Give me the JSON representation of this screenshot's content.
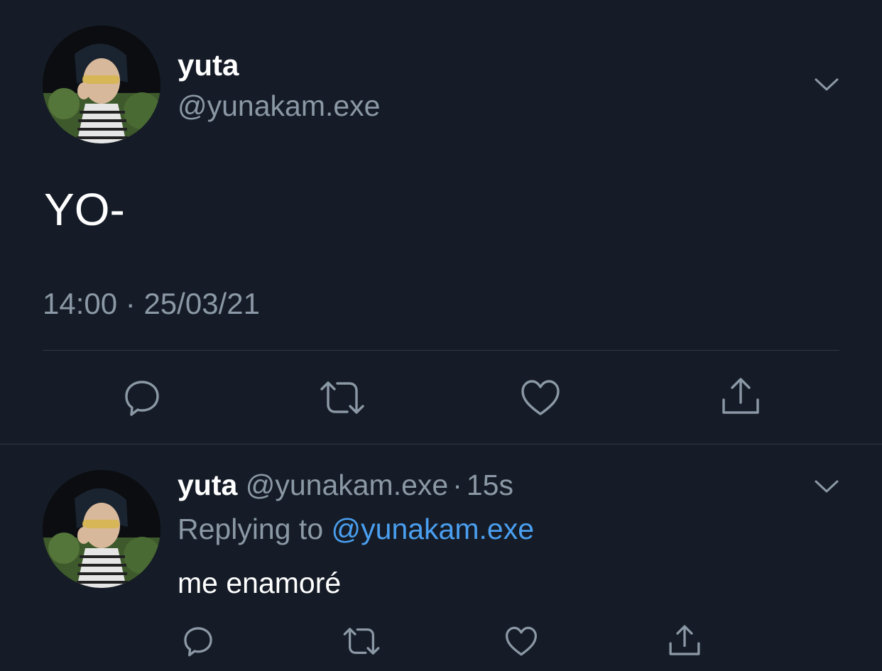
{
  "main_tweet": {
    "display_name": "yuta",
    "handle": "@yunakam.exe",
    "text": "YO-",
    "time": "14:00",
    "separator": "·",
    "date": "25/03/21",
    "actions": [
      "reply-icon",
      "retweet-icon",
      "like-icon",
      "share-icon"
    ]
  },
  "reply_tweet": {
    "display_name": "yuta",
    "handle": "@yunakam.exe",
    "separator": "·",
    "time_ago": "15s",
    "replying_label": "Replying to",
    "replying_to": "@yunakam.exe",
    "text": "me enamoré",
    "actions": [
      "reply-icon",
      "retweet-icon",
      "like-icon",
      "share-icon"
    ]
  },
  "colors": {
    "background": "#151c27",
    "text_primary": "#ffffff",
    "text_secondary": "#8b98a5",
    "link": "#4a9ff0",
    "divider": "#2f3947"
  }
}
